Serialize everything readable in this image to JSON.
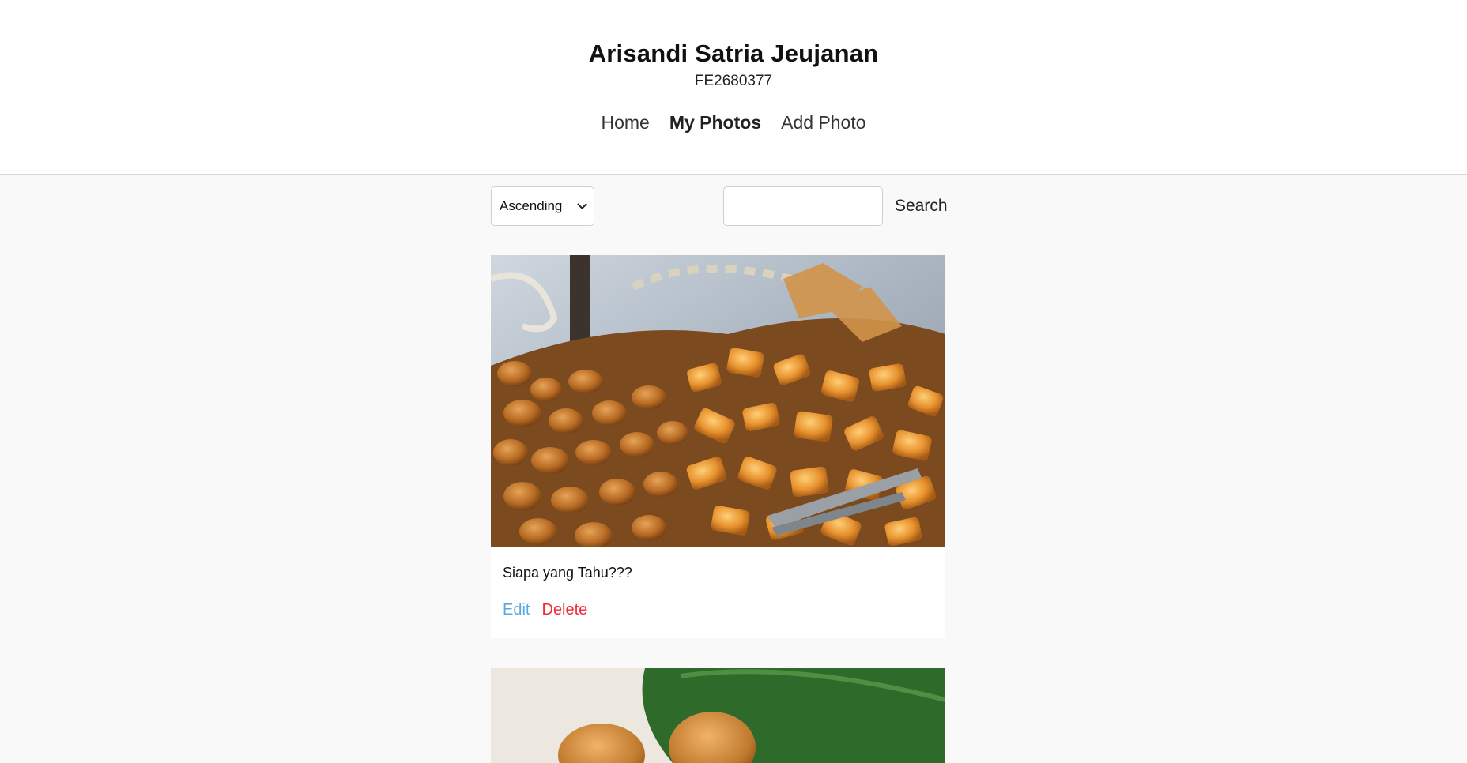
{
  "header": {
    "title": "Arisandi Satria Jeujanan",
    "subtitle": "FE2680377"
  },
  "nav": {
    "items": [
      {
        "label": "Home",
        "active": false
      },
      {
        "label": "My Photos",
        "active": true
      },
      {
        "label": "Add Photo",
        "active": false
      }
    ]
  },
  "toolbar": {
    "sort_value": "Ascending",
    "search_value": "",
    "search_label": "Search"
  },
  "photos": [
    {
      "caption": "Siapa yang Tahu???",
      "edit_label": "Edit",
      "delete_label": "Delete",
      "image": "fried-tofu-snacks-photo"
    },
    {
      "caption": "",
      "image": "fried-food-on-banana-leaf-photo"
    }
  ],
  "colors": {
    "edit": "#5aa8df",
    "delete": "#ef2b3a",
    "page_background": "#f9f9f9"
  }
}
